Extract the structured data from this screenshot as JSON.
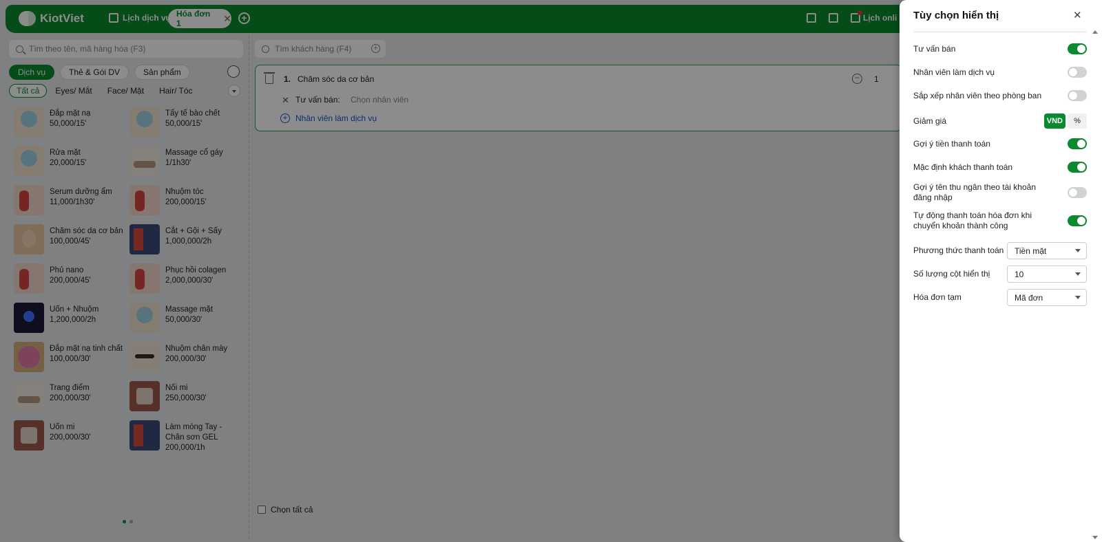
{
  "topbar": {
    "brand": "KiotViet",
    "schedule_label": "Lịch dịch vụ",
    "active_tab": "Hóa đơn 1",
    "tab_close": "✕",
    "add_tab": "+",
    "right_schedule_label": "Lịch onli"
  },
  "left": {
    "search_placeholder": "Tìm theo tên, mã hàng hóa (F3)",
    "categories": [
      "Dịch vụ",
      "Thẻ & Gói DV",
      "Sản phẩm"
    ],
    "subcategories": [
      "Tất cả",
      "Eyes/ Mắt",
      "Face/ Mặt",
      "Hair/ Tóc"
    ],
    "items": [
      {
        "name": "Đắp mặt nạ",
        "price": "50,000/15'"
      },
      {
        "name": "Tẩy tế bào chết",
        "price": "50,000/15'"
      },
      {
        "name": "Rửa mặt",
        "price": "20,000/15'"
      },
      {
        "name": "Massage cổ gáy",
        "price": "1/1h30'"
      },
      {
        "name": "Serum dưỡng ẩm",
        "price": "11,000/1h30'"
      },
      {
        "name": "Nhuộm tóc",
        "price": "200,000/15'"
      },
      {
        "name": "Chăm sóc da cơ bản",
        "price": "100,000/45'"
      },
      {
        "name": "Cắt + Gội + Sấy",
        "price": "1,000,000/2h"
      },
      {
        "name": "Phủ nano",
        "price": "200,000/45'"
      },
      {
        "name": "Phục hồi colagen",
        "price": "2,000,000/30'"
      },
      {
        "name": "Uốn + Nhuộm",
        "price": "1,200,000/2h"
      },
      {
        "name": "Massage mặt",
        "price": "50,000/30'"
      },
      {
        "name": "Đắp mặt nạ tinh chất",
        "price": "100,000/30'"
      },
      {
        "name": "Nhuộm chân mày",
        "price": "200,000/30'"
      },
      {
        "name": "Trang điểm",
        "price": "200,000/30'"
      },
      {
        "name": "Nối mi",
        "price": "250,000/30'"
      },
      {
        "name": "Uốn mi",
        "price": "200,000/30'"
      },
      {
        "name": "Làm móng Tay - Chân sơn GEL",
        "price": "200,000/1h"
      }
    ]
  },
  "middle": {
    "customer_placeholder": "Tìm khách hàng (F4)",
    "line": {
      "number": "1.",
      "name": "Chăm sóc da cơ bản",
      "qty": "1",
      "advisor_label": "Tư vấn bán:",
      "advisor_value": "Chọn nhân viên",
      "add_staff": "Nhân viên làm dịch vụ"
    },
    "select_all": "Chọn tất cả"
  },
  "drawer": {
    "title": "Tùy chọn hiển thị",
    "close": "✕",
    "toggles": [
      {
        "label": "Tư vấn bán",
        "on": true
      },
      {
        "label": "Nhân viên làm dịch vụ",
        "on": false
      },
      {
        "label": "Sắp xếp nhân viên theo phòng ban",
        "on": false
      }
    ],
    "discount": {
      "label": "Giảm giá",
      "options": [
        "VND",
        "%"
      ],
      "selected": "VND"
    },
    "toggles2": [
      {
        "label": "Gợi ý tiền thanh toán",
        "on": true
      },
      {
        "label": "Mặc định khách thanh toán",
        "on": true
      },
      {
        "label": "Gợi ý tên thu ngân theo tài khoản đăng nhập",
        "on": false
      },
      {
        "label": "Tự động thanh toán hóa đơn khi chuyển khoản thành công",
        "on": true
      }
    ],
    "selects": [
      {
        "label": "Phương thức thanh toán",
        "value": "Tiền mặt"
      },
      {
        "label": "Số lượng cột hiển thị",
        "value": "10"
      },
      {
        "label": "Hóa đơn tạm",
        "value": "Mã đơn"
      }
    ]
  },
  "colors": {
    "brand": "#0a8a2e",
    "link": "#1a56c4"
  }
}
